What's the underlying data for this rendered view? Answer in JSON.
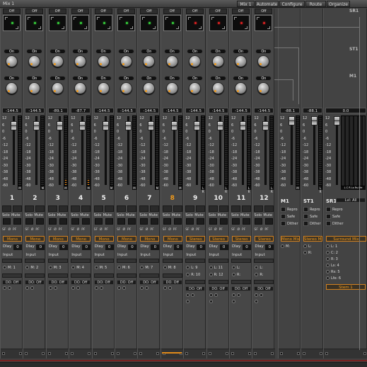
{
  "window": {
    "title": "Mix 1",
    "buttons": [
      "Mix 1",
      "Automate",
      "Configure",
      "Route",
      "Organize"
    ]
  },
  "row_labels": [
    "SR1",
    "ST1",
    "M1"
  ],
  "channels": [
    {
      "label": "1",
      "insert": "Off",
      "led": "#36d13b",
      "sends": [
        "On",
        "On"
      ],
      "vol": "-144.5",
      "fmt": "Mono",
      "delay": "0",
      "in_label": "M: 1",
      "fader": 0.78,
      "meter": 0.0
    },
    {
      "label": "2",
      "insert": "Off",
      "led": "#36d13b",
      "sends": [
        "On",
        "On"
      ],
      "vol": "-144.5",
      "fmt": "Mono",
      "delay": "0",
      "in_label": "M: 2",
      "fader": 0.78,
      "meter": 0.0
    },
    {
      "label": "3",
      "insert": "Off",
      "led": "#36d13b",
      "sends": [
        "On",
        "On"
      ],
      "vol": "-89.1",
      "fmt": "Mono",
      "delay": "0",
      "in_label": "M: 3",
      "fader": 0.78,
      "meter": 0.08
    },
    {
      "label": "4",
      "insert": "Off",
      "led": "#36d13b",
      "sends": [
        "On",
        "On"
      ],
      "vol": "-87.7",
      "fmt": "Mono",
      "delay": "0",
      "in_label": "M: 4",
      "fader": 0.78,
      "meter": 0.08
    },
    {
      "label": "5",
      "insert": "Off",
      "led": "#36d13b",
      "sends": [
        "On",
        "On"
      ],
      "vol": "-144.5",
      "fmt": "Mono",
      "delay": "0",
      "in_label": "M: 5",
      "fader": 0.78,
      "meter": 0.0
    },
    {
      "label": "6",
      "insert": "Off",
      "led": "#36d13b",
      "sends": [
        "On",
        "On"
      ],
      "vol": "-144.5",
      "fmt": "Mono",
      "delay": "0",
      "in_label": "M: 6",
      "fader": 0.78,
      "meter": 0.0
    },
    {
      "label": "7",
      "insert": "Off",
      "led": "#36d13b",
      "sends": [
        "On",
        "On"
      ],
      "vol": "-144.5",
      "fmt": "Mono",
      "delay": "0",
      "in_label": "M: 7",
      "fader": 0.78,
      "meter": 0.0
    },
    {
      "label": "8",
      "insert": "Off",
      "led": "#36d13b",
      "sends": [
        "On",
        "On"
      ],
      "vol": "-144.5",
      "fmt": "Mono",
      "delay": "0",
      "in_label": "M: 8",
      "fader": 0.78,
      "meter": 0.0,
      "selected": true
    },
    {
      "label": "9",
      "insert": "Off",
      "led": "#e02222",
      "sends": [
        "On",
        "On"
      ],
      "vol": "-144.5",
      "fmt": "Stereo",
      "delay": "0",
      "in_label": "L: 9",
      "in_label2": "R: 10",
      "fader": 0.78,
      "meter": 0.0,
      "stereo": true
    },
    {
      "label": "10",
      "insert": "Off",
      "led": "#e02222",
      "sends": [
        "On",
        "On"
      ],
      "vol": "-144.5",
      "fmt": "Stereo",
      "delay": "0",
      "in_label": "L: 11",
      "in_label2": "R: 12",
      "fader": 0.78,
      "meter": 0.0,
      "stereo": true
    },
    {
      "label": "11",
      "insert": "Off",
      "led": "#e02222",
      "sends": [
        "On",
        "On"
      ],
      "vol": "-144.5",
      "fmt": "Stereo",
      "delay": "0",
      "in_label": "L:",
      "in_label2": "R:",
      "fader": 0.78,
      "meter": 0.0,
      "stereo": true
    },
    {
      "label": "12",
      "insert": "Off",
      "led": "#e02222",
      "sends": [
        "On",
        "On"
      ],
      "vol": "-144.5",
      "fmt": "Stereo",
      "delay": "0",
      "in_label": "L:",
      "in_label2": "R:",
      "fader": 0.78,
      "meter": 0.0,
      "stereo": true
    }
  ],
  "scale": [
    "12",
    "6",
    "0",
    "-6",
    "-12",
    "-18",
    "-24",
    "-30",
    "-38",
    "-48",
    "-60"
  ],
  "strip_text": {
    "solo": "Solo",
    "mute": "Mute",
    "sf": "SF",
    "phase": "Ø",
    "pf": "PF",
    "delay": "Dlay",
    "input": "Input",
    "do_off": "DO: Off",
    "meter_foot": "M",
    "meter_foot_st": "L R"
  },
  "buses": [
    {
      "label": "M1",
      "vol": "-88.1",
      "fmt": "Mono Mix",
      "fader": 0.78,
      "checks": [
        "Repro",
        "Safe",
        "Dither"
      ],
      "outs": [
        "M:"
      ]
    },
    {
      "label": "ST1",
      "vol": "-88.1",
      "fmt": "Stereo Mix",
      "fader": 0.78,
      "checks": [
        "Repro",
        "Safe",
        "Dither"
      ],
      "outs": [
        "L:",
        "R:"
      ]
    },
    {
      "label": "SR1",
      "vol": "0.0",
      "fmt": "Surround Mix",
      "lvl": "Lvl: All",
      "checks": [
        "Repro",
        "Safe",
        "Dither"
      ],
      "outs": [
        "L: 1",
        "C: 2",
        "R: 3",
        "Ls: 4",
        "Rs: 5",
        "Lfe: 6"
      ],
      "stem": "Stem 1",
      "meter_labels": "L C R Ls Rs Lfe"
    }
  ],
  "colors": {
    "accent": "#f09a1c",
    "green": "#36d13b",
    "red": "#e02222"
  }
}
